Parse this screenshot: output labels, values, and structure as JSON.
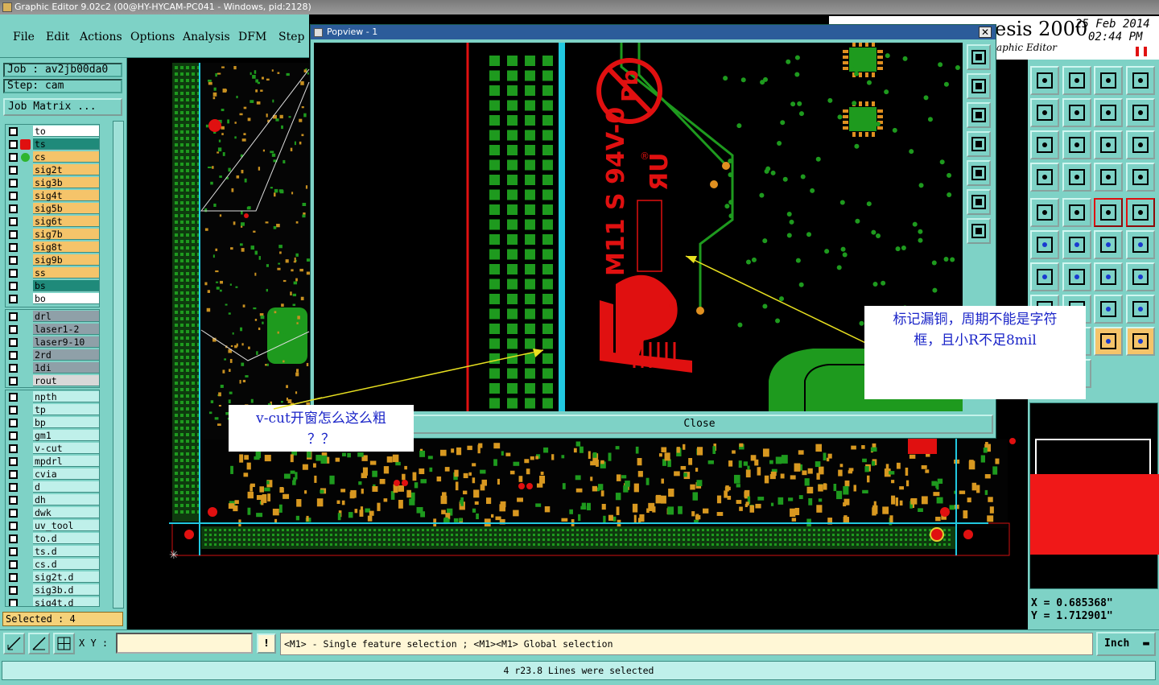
{
  "window": {
    "title": "Graphic Editor 9.02c2 (00@HY-HYCAM-PC041 - Windows, pid:2128)"
  },
  "menu": [
    "File",
    "Edit",
    "Actions",
    "Options",
    "Analysis",
    "DFM",
    "Step"
  ],
  "job": {
    "job": "Job : av2jb00da0",
    "step": "Step: cam",
    "matrix": "Job Matrix ..."
  },
  "layers_top": [
    {
      "name": "to",
      "bg": "#ffffff"
    },
    {
      "name": "ts",
      "bg": "#1f8a7a"
    },
    {
      "name": "cs",
      "bg": "#f5c46a"
    },
    {
      "name": "sig2t",
      "bg": "#f5c46a"
    },
    {
      "name": "sig3b",
      "bg": "#f5c46a"
    },
    {
      "name": "sig4t",
      "bg": "#f5c46a"
    },
    {
      "name": "sig5b",
      "bg": "#f5c46a"
    },
    {
      "name": "sig6t",
      "bg": "#f5c46a"
    },
    {
      "name": "sig7b",
      "bg": "#f5c46a"
    },
    {
      "name": "sig8t",
      "bg": "#f5c46a"
    },
    {
      "name": "sig9b",
      "bg": "#f5c46a"
    },
    {
      "name": "ss",
      "bg": "#f5c46a"
    },
    {
      "name": "bs",
      "bg": "#1f8a7a"
    },
    {
      "name": "bo",
      "bg": "#ffffff"
    }
  ],
  "layers_drill": [
    {
      "name": "drl",
      "bg": "#8fa0a8"
    },
    {
      "name": "laser1-2",
      "bg": "#8fa0a8"
    },
    {
      "name": "laser9-10",
      "bg": "#8fa0a8"
    },
    {
      "name": "2rd",
      "bg": "#8fa0a8"
    },
    {
      "name": "1di",
      "bg": "#8fa0a8"
    },
    {
      "name": "rout",
      "bg": "#d8d8d8"
    }
  ],
  "layers_misc": [
    "npth",
    "tp",
    "bp",
    "gm1",
    "v-cut",
    "mpdrl",
    "cvia",
    "d",
    "dh",
    "dwk",
    "uv_tool",
    "to.d",
    "ts.d",
    "cs.d",
    "sig2t.d",
    "sig3b.d",
    "sig4t.d"
  ],
  "selected": "Selected : 4",
  "header": {
    "brand": "esis 2000",
    "subtitle": "aphic Editor",
    "date": "25 Feb 2014",
    "time": "02:44 PM"
  },
  "coords": {
    "x": "X = 0.685368\"",
    "y": "Y = 1.712901\""
  },
  "bottom": {
    "xy_label": "X Y :",
    "xy_value": "",
    "hint": "<M1> - Single feature selection ; <M1><M1> Global selection",
    "units": "Inch"
  },
  "status": "4 r23.8 Lines were selected",
  "popup": {
    "title": "Popview - 1",
    "close": "Close",
    "marking": "M11 S 94V-0"
  },
  "notes": {
    "vcut": "v-cut开窗怎么这么粗\n？？",
    "mark": "标记漏铜，周期不能是字符\n框，且小R不足8mil"
  },
  "colors": {
    "panel": "#7ed2c6",
    "copper": "#1e9a1e",
    "silk": "#e01010",
    "vcut": "#21c8e0"
  }
}
